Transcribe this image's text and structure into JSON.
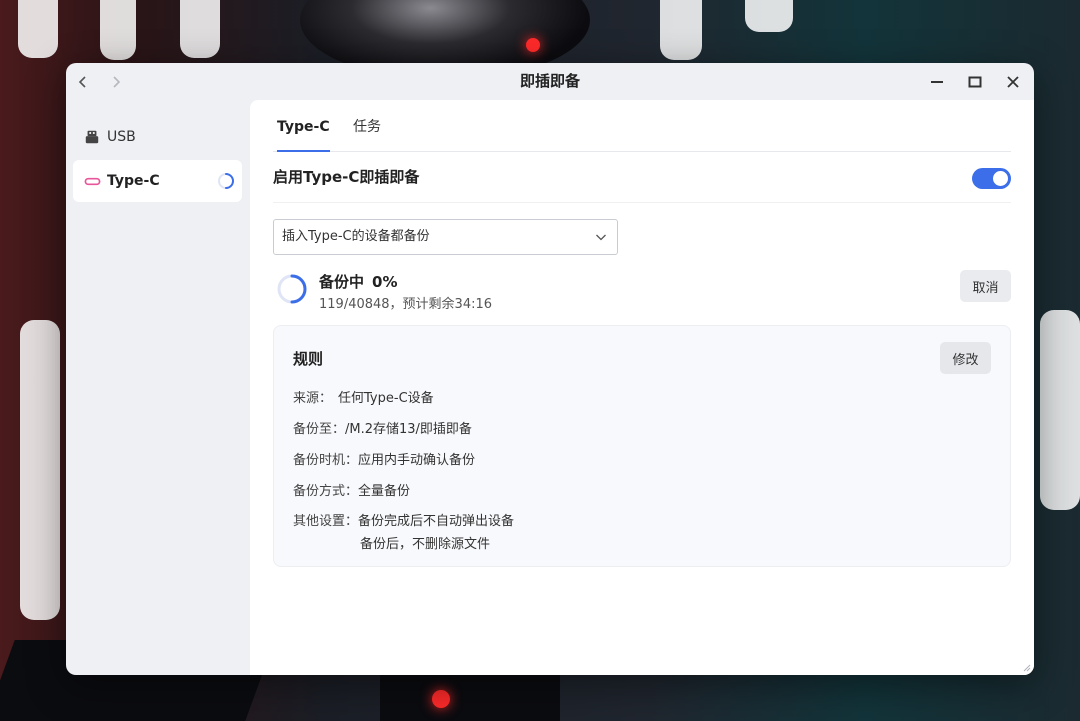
{
  "window": {
    "title": "即插即备"
  },
  "sidebar": {
    "items": [
      {
        "label": "USB",
        "icon": "usb-icon",
        "active": false
      },
      {
        "label": "Type-C",
        "icon": "type-c-icon",
        "active": true,
        "status": "loading-spinner-icon"
      }
    ]
  },
  "tabs": [
    {
      "label": "Type-C",
      "active": true
    },
    {
      "label": "任务",
      "active": false
    }
  ],
  "enable": {
    "label": "启用Type-C即插即备",
    "enabled": true
  },
  "mode_select": {
    "value": "插入Type-C的设备都备份"
  },
  "backup_status": {
    "title": "备份中",
    "percent": "0%",
    "progress": 0,
    "detail": "119/40848，预计剩余34:16",
    "cancel_label": "取消"
  },
  "rules": {
    "title": "规则",
    "edit_label": "修改",
    "items": [
      {
        "key": "来源：",
        "value": "任何Type-C设备"
      },
      {
        "key": "备份至：",
        "value": "/M.2存储13/即插即备"
      },
      {
        "key": "备份时机：",
        "value": "应用内手动确认备份"
      },
      {
        "key": "备份方式：",
        "value": "全量备份"
      },
      {
        "key": "其他设置：",
        "value": "备份完成后不自动弹出设备",
        "value2": "备份后，不删除源文件"
      }
    ]
  },
  "colors": {
    "accent": "#3b6ee8",
    "type_c_icon": "#e8559a"
  }
}
